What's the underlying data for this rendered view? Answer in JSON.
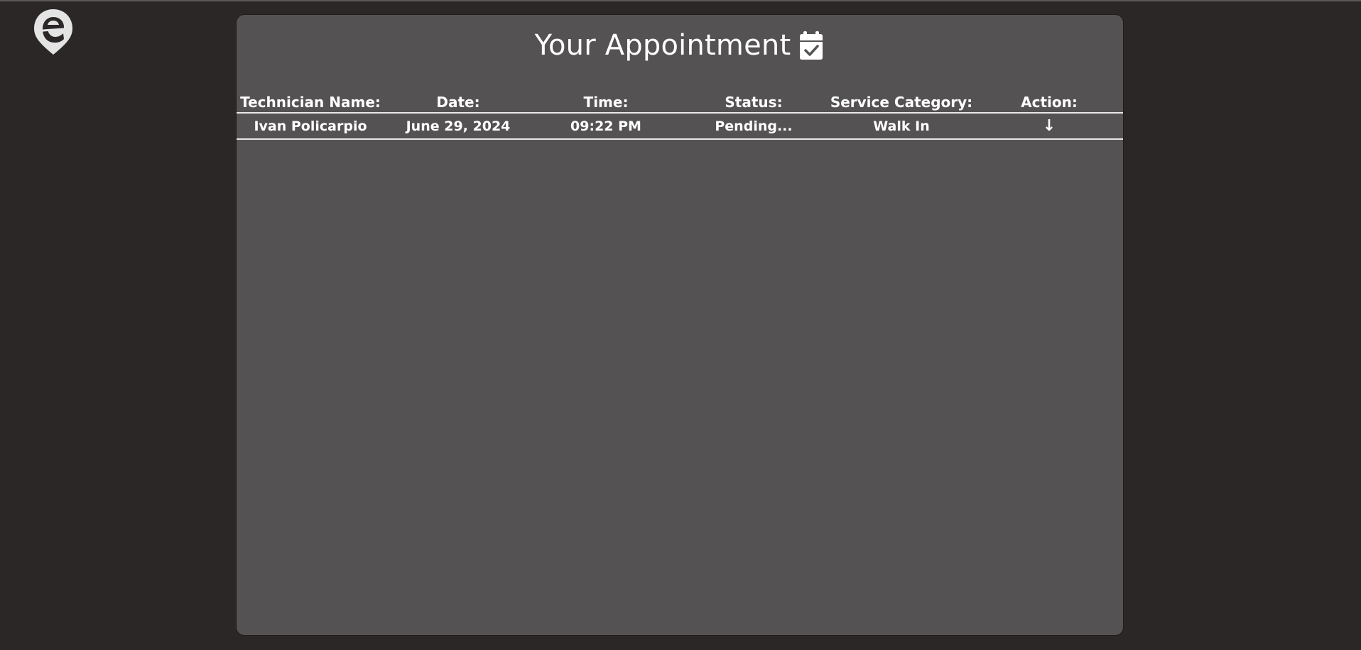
{
  "page": {
    "title": "Your Appointment",
    "title_icon": "calendar-check-icon",
    "logo_icon": "e-pin-logo"
  },
  "table": {
    "headers": [
      "Technician Name:",
      "Date:",
      "Time:",
      "Status:",
      "Service Category:",
      "Action:"
    ],
    "rows": [
      {
        "technician": "Ivan Policarpio",
        "date": "June 29, 2024",
        "time": "09:22 PM",
        "status": "Pending...",
        "category": "Walk In",
        "action": "↓",
        "action_icon": "arrow-down-icon"
      }
    ]
  },
  "colors": {
    "background": "#2b2727",
    "panel": "#545253",
    "text": "#ffffff",
    "divider": "#e8e8e8"
  }
}
